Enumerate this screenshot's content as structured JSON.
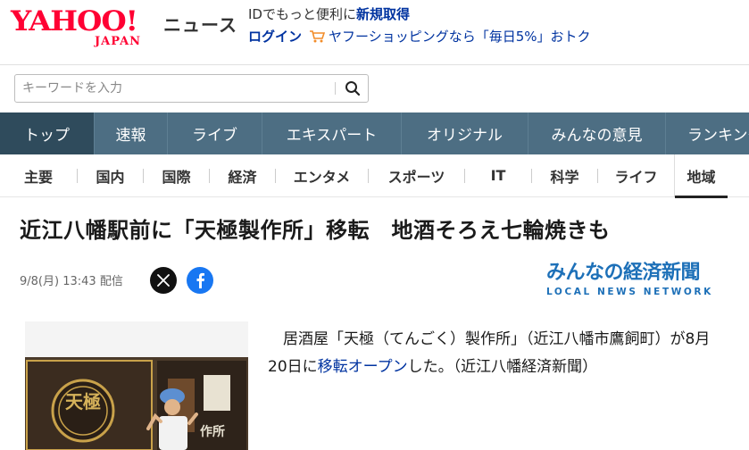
{
  "header": {
    "logo_main": "YAHOO!",
    "logo_sub": "JAPAN",
    "service_name": "ニュース",
    "promo_text": "IDでもっと便利に",
    "promo_link": "新規取得",
    "login_label": "ログイン",
    "shopping_text": "ヤフーショッピングなら「毎日5%」おトク"
  },
  "search": {
    "placeholder": "キーワードを入力",
    "button_icon": "search-icon"
  },
  "main_nav": [
    {
      "label": "トップ",
      "active": true
    },
    {
      "label": "速報",
      "active": false
    },
    {
      "label": "ライブ",
      "active": false
    },
    {
      "label": "エキスパート",
      "active": false
    },
    {
      "label": "オリジナル",
      "active": false
    },
    {
      "label": "みんなの意見",
      "active": false
    },
    {
      "label": "ランキング",
      "active": false
    }
  ],
  "sub_nav": [
    {
      "label": "主要",
      "active": false
    },
    {
      "label": "国内",
      "active": false
    },
    {
      "label": "国際",
      "active": false
    },
    {
      "label": "経済",
      "active": false
    },
    {
      "label": "エンタメ",
      "active": false
    },
    {
      "label": "スポーツ",
      "active": false
    },
    {
      "label": "IT",
      "active": false
    },
    {
      "label": "科学",
      "active": false
    },
    {
      "label": "ライフ",
      "active": false
    },
    {
      "label": "地域",
      "active": true
    }
  ],
  "article": {
    "headline": "近江八幡駅前に「天極製作所」移転　地酒そろえ七輪焼きも",
    "datetime": "9/8(月) 13:43",
    "delivery_label": "配信",
    "publisher_name": "みんなの経済新聞",
    "publisher_sub": "LOCAL NEWS NETWORK",
    "body_pre": "居酒屋「天極（てんごく）製作所」（近江八幡市鷹飼町）が8月20日に",
    "body_link": "移転オープン",
    "body_post": "した。（近江八幡経済新聞）",
    "photo_sign": "天極",
    "photo_shop_text": "作所"
  },
  "colors": {
    "brand_red": "#ff0033",
    "nav_bg": "#4d6e83",
    "nav_active": "#2f4b5c",
    "link_blue": "#0033a0",
    "publisher_blue": "#1d70b8"
  }
}
